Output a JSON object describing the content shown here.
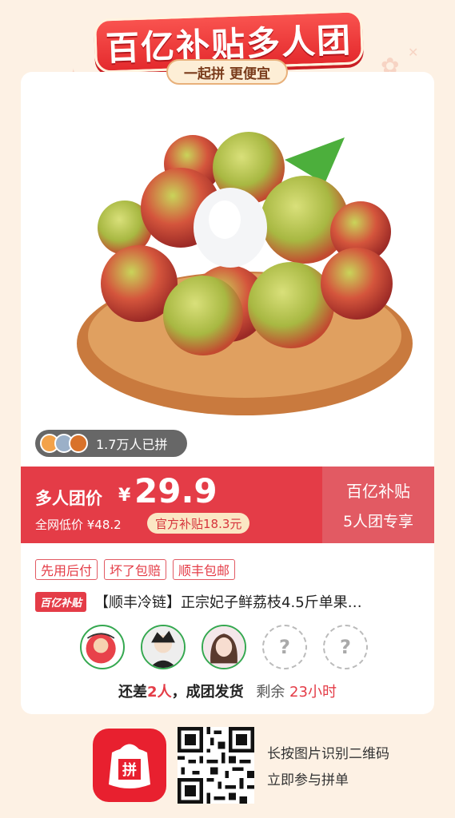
{
  "header": {
    "banner_title": "百亿补贴多人团",
    "tagline": "一起拼 更便宜"
  },
  "product": {
    "image_desc_icon": "lychee-image",
    "joined_count": "1.7万人已拼",
    "title": "【顺丰冷链】正宗妃子鲜荔枝4.5斤单果…",
    "brand_badge": "百亿补贴"
  },
  "price": {
    "group_label": "多人团价",
    "currency": "¥",
    "value": "29.9",
    "low_price": "全网低价 ¥48.2",
    "subsidy": "官方补贴18.3元",
    "right_line1": "百亿补贴",
    "right_line2": "5人团专享"
  },
  "tags": [
    "先用后付",
    "坏了包赔",
    "顺丰包邮"
  ],
  "status": {
    "prefix": "还差",
    "count": "2人",
    "suffix": "，成团发货",
    "remaining_label": "剩余",
    "remaining_time": "23小时"
  },
  "footer": {
    "line1": "长按图片识别二维码",
    "line2": "立即参与拼单"
  },
  "colors": {
    "accent": "#e43c47",
    "background": "#fdf1e4"
  }
}
